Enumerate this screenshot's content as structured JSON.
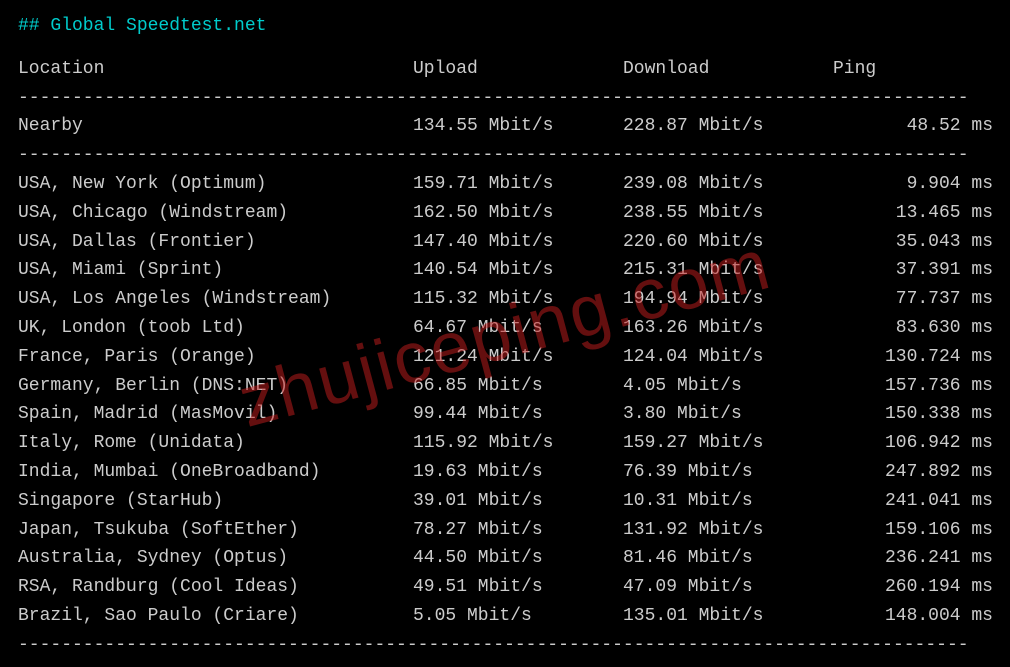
{
  "title": "## Global Speedtest.net",
  "headers": {
    "location": "Location",
    "upload": "Upload",
    "download": "Download",
    "ping": "Ping"
  },
  "nearby": {
    "location": "Nearby",
    "upload": "134.55 Mbit/s",
    "download": "228.87 Mbit/s",
    "ping": "48.52 ms"
  },
  "rows": [
    {
      "location": "USA, New York (Optimum)",
      "upload": "159.71 Mbit/s",
      "download": "239.08 Mbit/s",
      "ping": "9.904 ms"
    },
    {
      "location": "USA, Chicago (Windstream)",
      "upload": "162.50 Mbit/s",
      "download": "238.55 Mbit/s",
      "ping": "13.465 ms"
    },
    {
      "location": "USA, Dallas (Frontier)",
      "upload": "147.40 Mbit/s",
      "download": "220.60 Mbit/s",
      "ping": "35.043 ms"
    },
    {
      "location": "USA, Miami (Sprint)",
      "upload": "140.54 Mbit/s",
      "download": "215.31 Mbit/s",
      "ping": "37.391 ms"
    },
    {
      "location": "USA, Los Angeles (Windstream)",
      "upload": "115.32 Mbit/s",
      "download": "194.94 Mbit/s",
      "ping": "77.737 ms"
    },
    {
      "location": "UK, London (toob Ltd)",
      "upload": "64.67 Mbit/s",
      "download": "163.26 Mbit/s",
      "ping": "83.630 ms"
    },
    {
      "location": "France, Paris (Orange)",
      "upload": "121.24 Mbit/s",
      "download": "124.04 Mbit/s",
      "ping": "130.724 ms"
    },
    {
      "location": "Germany, Berlin (DNS:NET)",
      "upload": "66.85 Mbit/s",
      "download": "4.05 Mbit/s",
      "ping": "157.736 ms"
    },
    {
      "location": "Spain, Madrid (MasMovil)",
      "upload": "99.44 Mbit/s",
      "download": "3.80 Mbit/s",
      "ping": "150.338 ms"
    },
    {
      "location": "Italy, Rome (Unidata)",
      "upload": "115.92 Mbit/s",
      "download": "159.27 Mbit/s",
      "ping": "106.942 ms"
    },
    {
      "location": "India, Mumbai (OneBroadband)",
      "upload": "19.63 Mbit/s",
      "download": "76.39 Mbit/s",
      "ping": "247.892 ms"
    },
    {
      "location": "Singapore (StarHub)",
      "upload": "39.01 Mbit/s",
      "download": "10.31 Mbit/s",
      "ping": "241.041 ms"
    },
    {
      "location": "Japan, Tsukuba (SoftEther)",
      "upload": "78.27 Mbit/s",
      "download": "131.92 Mbit/s",
      "ping": "159.106 ms"
    },
    {
      "location": "Australia, Sydney (Optus)",
      "upload": "44.50 Mbit/s",
      "download": "81.46 Mbit/s",
      "ping": "236.241 ms"
    },
    {
      "location": "RSA, Randburg (Cool Ideas)",
      "upload": "49.51 Mbit/s",
      "download": "47.09 Mbit/s",
      "ping": "260.194 ms"
    },
    {
      "location": "Brazil, Sao Paulo (Criare)",
      "upload": "5.05 Mbit/s",
      "download": "135.01 Mbit/s",
      "ping": "148.004 ms"
    }
  ],
  "divider": "----------------------------------------------------------------------------------------",
  "watermark": "zhujiceping.com"
}
